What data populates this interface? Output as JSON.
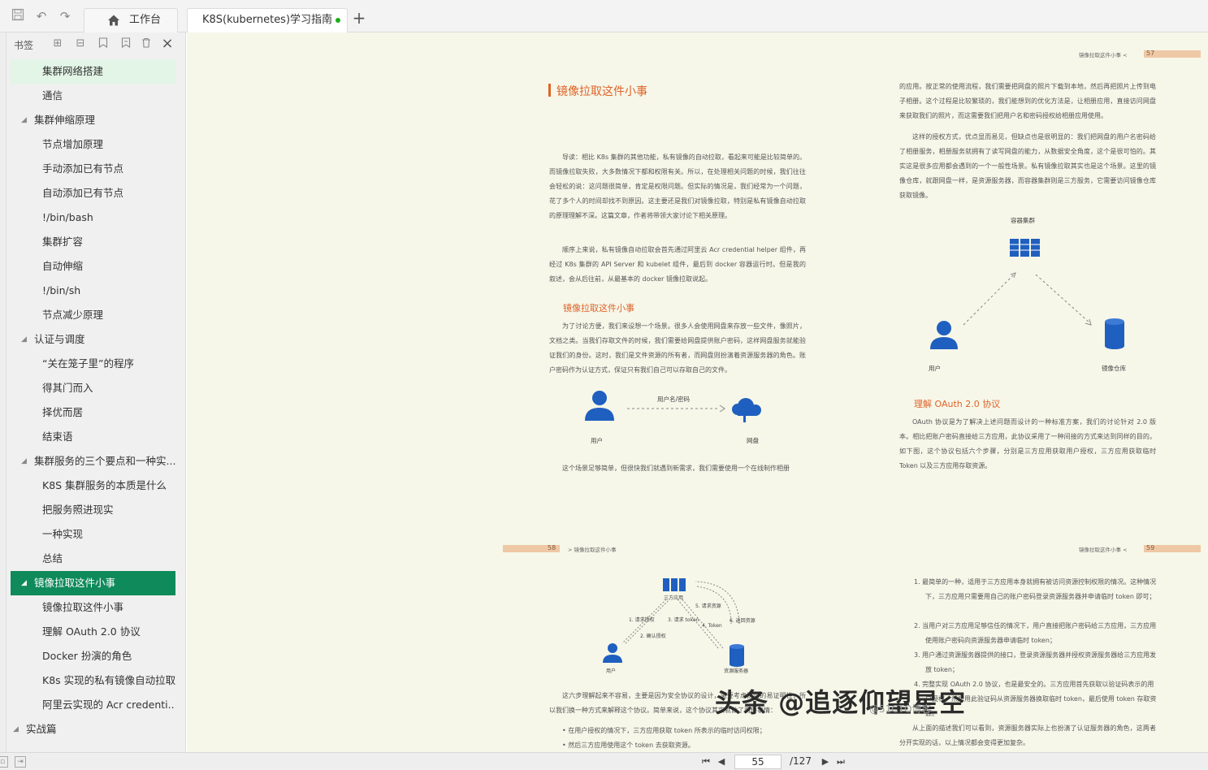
{
  "toolbar": {
    "home_tab": "工作台",
    "doc_tab": "K8S(kubernetes)学习指南",
    "new_tab": "+"
  },
  "sidebar": {
    "title": "书签",
    "items": [
      {
        "label": "集群网络搭建"
      },
      {
        "label": "通信"
      },
      {
        "label": "集群伸缩原理"
      },
      {
        "label": "节点增加原理"
      },
      {
        "label": "手动添加已有节点"
      },
      {
        "label": "自动添加已有节点"
      },
      {
        "label": "!/bin/bash"
      },
      {
        "label": "集群扩容"
      },
      {
        "label": "自动伸缩"
      },
      {
        "label": "!/bin/sh"
      },
      {
        "label": "节点减少原理"
      },
      {
        "label": "认证与调度"
      },
      {
        "label": "“关在笼子里”的程序"
      },
      {
        "label": "得其门而入"
      },
      {
        "label": "择优而居"
      },
      {
        "label": "结束语"
      },
      {
        "label": "集群服务的三个要点和一种实..."
      },
      {
        "label": "K8S 集群服务的本质是什么"
      },
      {
        "label": "把服务照进现实"
      },
      {
        "label": "一种实现"
      },
      {
        "label": "总结"
      },
      {
        "label": "镜像拉取这件小事"
      },
      {
        "label": "镜像拉取这件小事"
      },
      {
        "label": "理解 OAuth 2.0 协议"
      },
      {
        "label": "Docker 扮演的角色"
      },
      {
        "label": "K8s 实现的私有镜像自动拉取"
      },
      {
        "label": "阿里云实现的 Acr credenti..."
      },
      {
        "label": "实战篇"
      }
    ]
  },
  "page56": {
    "title": "镜像拉取这件小事",
    "intro1": "导读：相比 K8s 集群的其他功能，私有镜像的自动拉取，看起来可能是比较简单的。而镜像拉取失败，大多数情况下都和权限有关。所以，在处理相关问题的时候，我们往往会轻松的说：这问题很简单，肯定是权限问题。但实际的情况是，我们经常为一个问题，花了多个人的时间却找不到原因。这主要还是我们对镜像拉取，特别是私有镜像自动拉取的原理理解不深。这篇文章，作者将带领大家讨论下相关原理。",
    "intro2": "顺序上来说，私有镜像自动拉取会首先通过阿里云 Acr credential helper 组件，再经过 K8s 集群的 API Server 和 kubelet 组件，最后到 docker 容器运行时。但是我的叙述，会从后往前，从最基本的 docker 镜像拉取说起。",
    "section": "镜像拉取这件小事",
    "body": "为了讨论方便，我们来设想一个场景。很多人会使用网盘来存放一些文件，像照片，文档之类。当我们存取文件的时候，我们需要给网盘提供账户密码，这样网盘服务就能验证我们的身份。这时，我们是文件资源的所有者，而网盘则扮演着资源服务器的角色。账户密码作为认证方式，保证只有我们自己可以存取自己的文件。",
    "diagram_user": "用户",
    "diagram_disk": "网盘",
    "diagram_arrow": "用户名/密码",
    "body2": "这个场景足够简单，但很快我们就遇到新需求，我们需要使用一个在线制作相册"
  },
  "page57": {
    "num": "57",
    "running_title": "镜像拉取这件小事",
    "p1": "的应用。按正常的使用流程，我们需要把网盘的照片下载到本地，然后再把照片上传到电子相册。这个过程是比较繁琐的，我们能想到的优化方法是，让相册应用，直接访问网盘来获取我们的照片，而这需要我们把用户名和密码授权给相册应用使用。",
    "p2": "这样的授权方式，优点显而易见，但缺点也是很明显的：我们把网盘的用户名密码给了相册服务，相册服务就拥有了读写网盘的能力，从数据安全角度，这个是很可怕的。其实这是很多应用都会遇到的一个一般性场景。私有镜像拉取其实也是这个场景。这里的镜像仓库，就跟网盘一样，是资源服务器，而容器集群则是三方服务，它需要访问镜像仓库获取镜像。",
    "diagram_cluster": "容器集群",
    "diagram_user": "用户",
    "diagram_repo": "镜像仓库",
    "section": "理解 OAuth 2.0 协议",
    "p3": "OAuth 协议是为了解决上述问题而设计的一种标准方案，我们的讨论针对 2.0 版本。相比把账户密码直接给三方应用，此协议采用了一种间接的方式来达到同样的目的。如下图，这个协议包括六个步骤，分别是三方应用获取用户授权，三方应用获取临时 Token 以及三方应用存取资源。"
  },
  "page58": {
    "num": "58",
    "running_title": "镜像拉取这件小事",
    "d_third": "三方应用",
    "d_user": "用户",
    "d_res": "资源服务器",
    "d_s1": "1. 请求授权",
    "d_s2": "2. 确认授权",
    "d_s3": "3. 请求 token",
    "d_s4": "4. Token",
    "d_s5": "5. 请求资源",
    "d_s6": "6. 返回资源",
    "p1": "这六步理解起来不容易，主要是因为安全协议的设计，需要考虑协议的易证明性，所以我们换一种方式来解释这个协议。简单来说，这个协议其实就做了两件事情：",
    "b1": "在用户授权的情况下，三方应用获取 token 所表示的临时访问权限；",
    "b2": "然后三方应用使用这个 token 去获取资源。"
  },
  "page59": {
    "num": "59",
    "running_title": "镜像拉取这件小事",
    "l1": "1.  最简单的一种，适用于三方应用本身就拥有被访问资源控制权限的情况。这种情况下，三方应用只需要用自己的账户密码登录资源服务器并申请临时 token 即可；",
    "l2": "2.  当用户对三方应用足够信任的情况下，用户直接把账户密码给三方应用，三方应用使用账户密码向资源服务器申请临时 token；",
    "l3": "3.  用户通过资源服务器提供的接口，登录资源服务器并授权资源服务器给三方应用发放 token；",
    "l4": "4.  完整实现 OAuth 2.0 协议，也是最安全的。三方应用首先获取以验证码表示的用户授权，然后用此验证码从资源服务器换取临时 token，最后使用 token 存取资源。",
    "tail": "从上面的描述我们可以看到，资源服务器实际上也扮演了认证服务器的角色，这两者分开实现的话，以上情况都会变得更加复杂。"
  },
  "watermark": "头条 @追逐仰望星空",
  "watermark_sub": "@51CTO博客",
  "status": {
    "page": "55",
    "total": "/127"
  },
  "colors": {
    "accent": "#e06329",
    "sidebar_active": "#0f8a5b",
    "page_bg": "#f6f7e9",
    "icon_blue": "#1f5fbf"
  }
}
